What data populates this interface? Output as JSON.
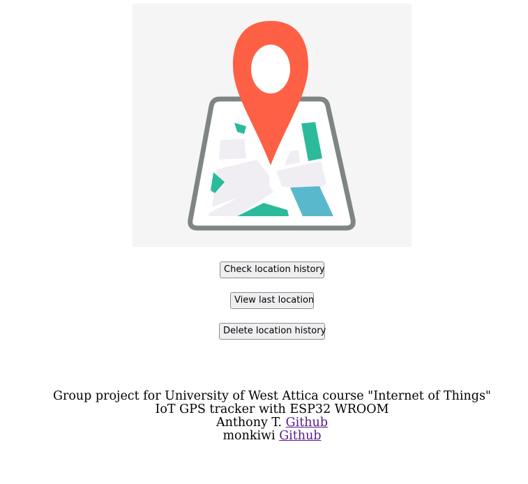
{
  "hero": {
    "icon": "map-pin-icon",
    "colors": {
      "background": "#f5f5f5",
      "pin": "#fe6045",
      "frame": "#7f8682",
      "green": "#2bbb9a",
      "blue": "#5ab8cc",
      "road": "#f0eef3"
    }
  },
  "buttons": {
    "check_history": "Check location history",
    "view_last": "View last location",
    "delete_history": "Delete location history"
  },
  "footer": {
    "line1": "Group project for University of West Attica course \"Internet of Things\"",
    "line2": "IoT GPS tracker with ESP32 WROOM",
    "author1_name": "Anthony T.",
    "author1_link": "Github",
    "author2_name": "monkiwi",
    "author2_link": "Github"
  }
}
